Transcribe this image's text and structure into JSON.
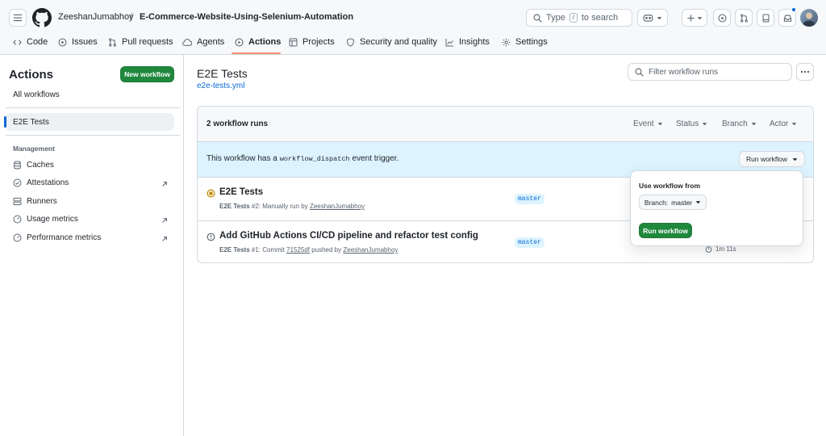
{
  "header": {
    "owner": "ZeeshanJumabhoy",
    "separator": "/",
    "repo": "E-Commerce-Website-Using-Selenium-Automation",
    "search_prefix": "Type",
    "search_key": "/",
    "search_suffix": "to search"
  },
  "nav": [
    {
      "label": "Code",
      "icon": "code-icon"
    },
    {
      "label": "Issues",
      "icon": "issue-opened-icon"
    },
    {
      "label": "Pull requests",
      "icon": "git-pull-request-icon"
    },
    {
      "label": "Agents",
      "icon": "cloud-agent-icon"
    },
    {
      "label": "Actions",
      "icon": "play-icon",
      "active": true
    },
    {
      "label": "Projects",
      "icon": "table-icon"
    },
    {
      "label": "Security and quality",
      "icon": "shield-icon"
    },
    {
      "label": "Insights",
      "icon": "graph-icon"
    },
    {
      "label": "Settings",
      "icon": "gear-icon"
    }
  ],
  "sidebar": {
    "title": "Actions",
    "new_workflow": "New workflow",
    "all_workflows": "All workflows",
    "active_workflow": "E2E Tests",
    "management_heading": "Management",
    "management": [
      {
        "label": "Caches",
        "icon": "database-icon",
        "external": false
      },
      {
        "label": "Attestations",
        "icon": "verified-icon",
        "external": true
      },
      {
        "label": "Runners",
        "icon": "server-icon",
        "external": false
      },
      {
        "label": "Usage metrics",
        "icon": "meter-icon",
        "external": true
      },
      {
        "label": "Performance metrics",
        "icon": "meter-icon",
        "external": true
      }
    ]
  },
  "main": {
    "title": "E2E Tests",
    "file": "e2e-tests.yml",
    "filter_placeholder": "Filter workflow runs",
    "runs_count": "2 workflow runs",
    "filters": [
      "Event",
      "Status",
      "Branch",
      "Actor"
    ],
    "banner": {
      "before": "This workflow has a",
      "code": "workflow_dispatch",
      "after": "event trigger.",
      "button": "Run workflow"
    },
    "runs": [
      {
        "title": "E2E Tests",
        "status": "in-progress",
        "workflow": "E2E Tests",
        "number": "#2:",
        "desc": "Manually run by",
        "user": "ZeeshanJumabhoy",
        "branch": "master"
      },
      {
        "title": "Add GitHub Actions CI/CD pipeline and refactor test config",
        "status": "failed",
        "workflow": "E2E Tests",
        "number": "#1:",
        "desc_before": "Commit",
        "commit": "71525df",
        "desc_after": "pushed by",
        "user": "ZeeshanJumabhoy",
        "branch": "master",
        "duration": "1m 11s"
      }
    ],
    "popup": {
      "label": "Use workflow from",
      "branch_prefix": "Branch:",
      "branch": "master",
      "button": "Run workflow"
    }
  },
  "colors": {
    "accent": "#0969da",
    "green": "#1f883d",
    "in_progress": "#bf8700",
    "nav_underline": "#fd8c73"
  }
}
